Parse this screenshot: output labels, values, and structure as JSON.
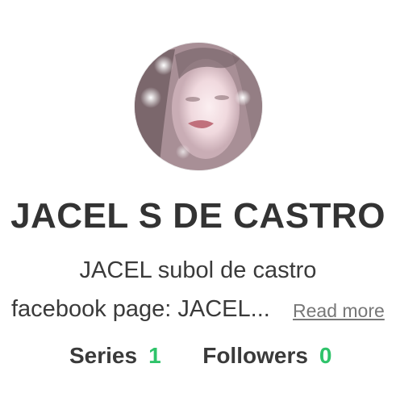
{
  "profile": {
    "avatar_icon": "profile-photo",
    "name": "JACEL S DE CASTRO",
    "bio_line1": "JACEL subol de castro",
    "bio_line2": "facebook page: JACEL...",
    "read_more": "Read more"
  },
  "stats": {
    "series_label": "Series",
    "series_value": "1",
    "followers_label": "Followers",
    "followers_value": "0"
  },
  "colors": {
    "accent": "#2fc36a",
    "text": "#333333",
    "link": "#777777"
  }
}
